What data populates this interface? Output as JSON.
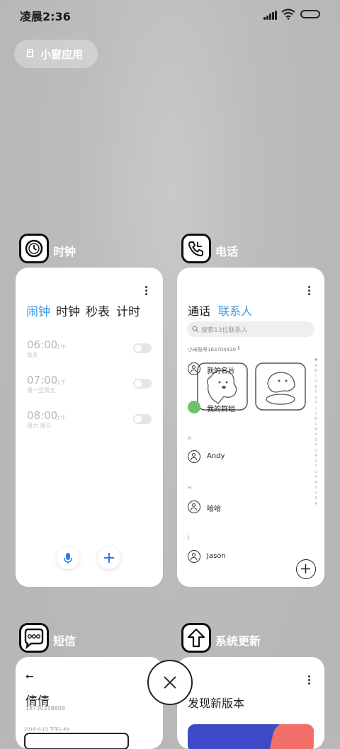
{
  "status_bar": {
    "time": "凌晨2:36"
  },
  "floating_apps_button": {
    "label": "小窗应用"
  },
  "apps": [
    {
      "title": "时钟"
    },
    {
      "title": "电话"
    },
    {
      "title": "短信"
    },
    {
      "title": "系统更新"
    }
  ],
  "clock": {
    "tabs": [
      "闹钟",
      "时钟",
      "秒表",
      "计时"
    ],
    "active_tab_color": "#3a96e0",
    "alarms": [
      {
        "time": "06:00",
        "ampm": "上午",
        "repeat": "每天",
        "enabled": false
      },
      {
        "time": "07:00",
        "ampm": "上午",
        "repeat": "周一至周五",
        "enabled": false
      },
      {
        "time": "08:00",
        "ampm": "上午",
        "repeat": "周六 周日",
        "enabled": false
      }
    ]
  },
  "phone": {
    "tabs": [
      "通话",
      "联系人"
    ],
    "active_tab_color": "#3a96e0",
    "search_placeholder": "搜索13位联系人",
    "account": "小米账号183704430",
    "my_card": "我的名片",
    "my_group": "我的群组",
    "sections": [
      {
        "letter": "A",
        "name": "Andy"
      },
      {
        "letter": "H",
        "name": "哈哈"
      },
      {
        "letter": "J",
        "name": "Jason"
      }
    ],
    "index": [
      "♥",
      "A",
      "B",
      "C",
      "D",
      "E",
      "F",
      "G",
      "H",
      "I",
      "J",
      "K",
      "L",
      "M",
      "N",
      "O",
      "P",
      "Q",
      "R",
      "S",
      "T",
      "U",
      "V",
      "W",
      "X",
      "Y",
      "Z",
      "#"
    ]
  },
  "messages": {
    "contact_name": "倩倩",
    "contact_number": "18730218809",
    "timestamp": "2016-6-13 下午1:49"
  },
  "update": {
    "heading": "发现新版本"
  }
}
